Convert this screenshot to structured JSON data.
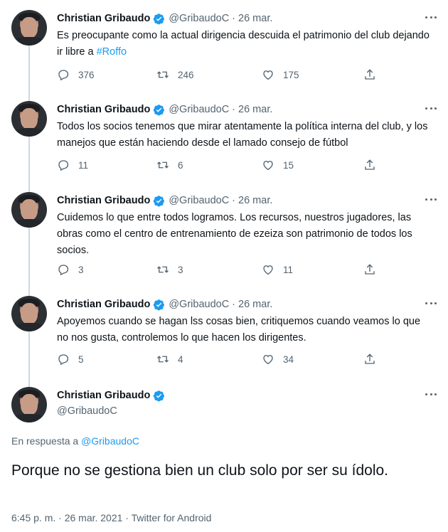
{
  "author": {
    "name": "Christian Gribaudo",
    "handle": "@GribaudoC",
    "verified": true
  },
  "dot": "·",
  "tweets": [
    {
      "date": "26 mar.",
      "text_before": "Es preocupante como la actual dirigencia descuida el patrimonio del club dejando ir libre a ",
      "hashtag": "#Roffo",
      "replies": "376",
      "retweets": "246",
      "likes": "175"
    },
    {
      "date": "26 mar.",
      "text": "Todos los socios tenemos que mirar atentamente la política interna del club, y los manejos que están haciendo desde el lamado consejo de fútbol",
      "replies": "11",
      "retweets": "6",
      "likes": "15"
    },
    {
      "date": "26 mar.",
      "text": "Cuidemos lo que entre todos logramos. Los recursos,  nuestros jugadores, las obras como el centro de entrenamiento de ezeiza son patrimonio de todos los socios.",
      "replies": "3",
      "retweets": "3",
      "likes": "11"
    },
    {
      "date": "26 mar.",
      "text": "Apoyemos cuando se hagan lss cosas bien, critiquemos cuando veamos lo que no nos gusta, controlemos lo que hacen los dirigentes.",
      "replies": "5",
      "retweets": "4",
      "likes": "34"
    }
  ],
  "main_tweet": {
    "reply_prefix": "En respuesta a ",
    "reply_handle": "@GribaudoC",
    "text": "Porque no se gestiona bien un club solo por ser su ídolo.",
    "meta": "6:45 p. m. · 26 mar. 2021 · Twitter for Android"
  },
  "colors": {
    "accent": "#1d9bf0",
    "secondary_text": "#536471",
    "thread_line": "#cfd9de"
  },
  "icons": [
    "verified-badge-icon",
    "more-icon",
    "reply-icon",
    "retweet-icon",
    "like-icon",
    "share-icon"
  ]
}
